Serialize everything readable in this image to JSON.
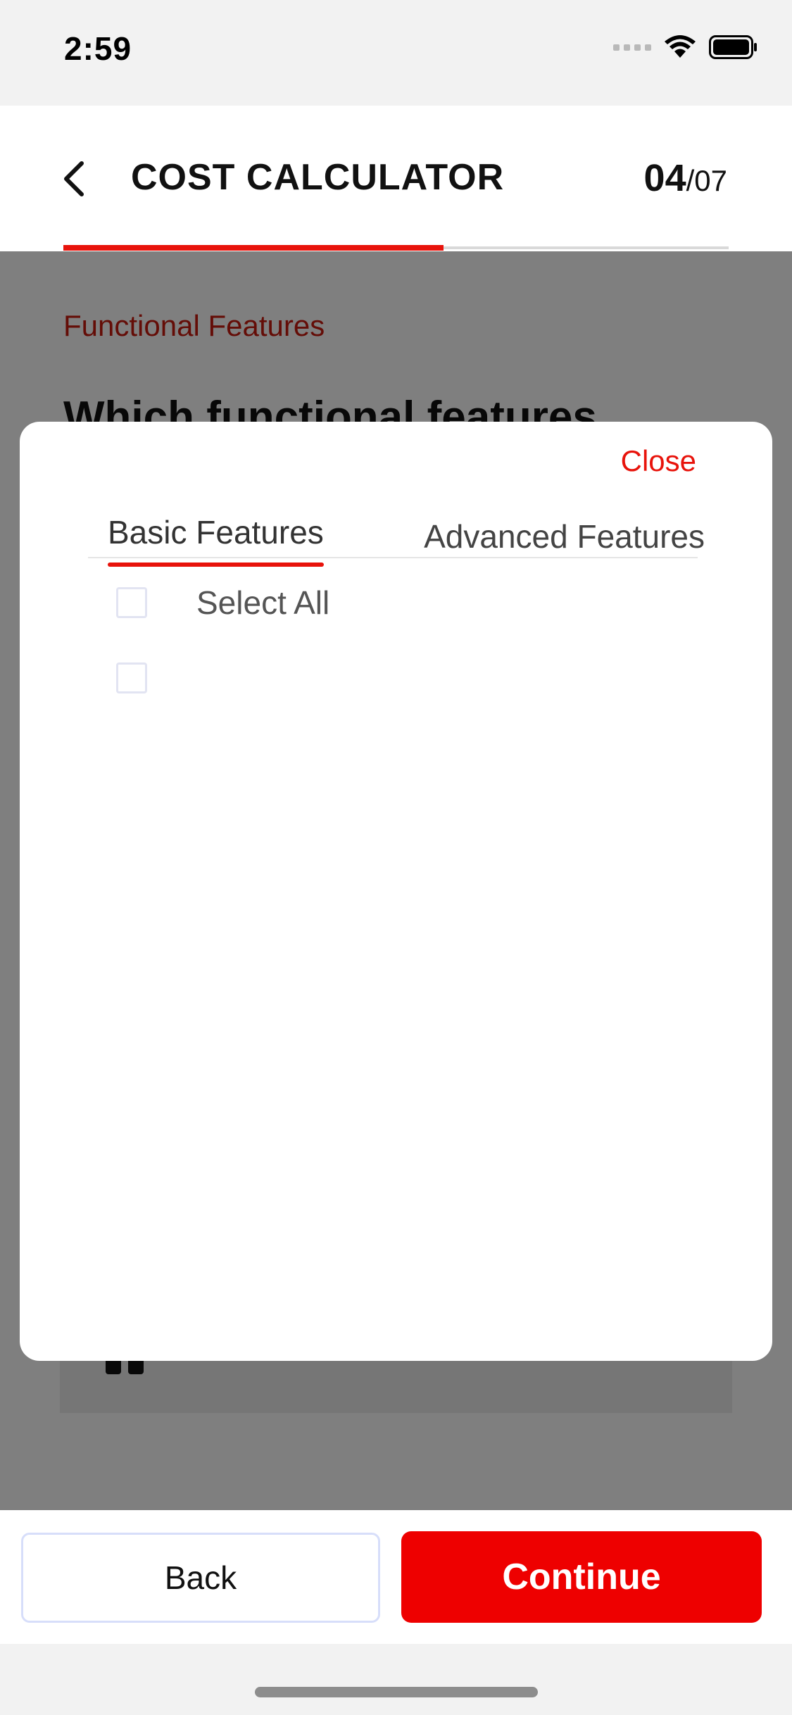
{
  "status_bar": {
    "time": "2:59"
  },
  "header": {
    "title": "COST CALCULATOR",
    "step_current": "04",
    "step_total": "/07",
    "progress_fraction": 0.5714
  },
  "content": {
    "section_label": "Functional Features",
    "question": "Which functional features"
  },
  "modal": {
    "close_label": "Close",
    "tabs": [
      {
        "label": "Basic Features",
        "active": true
      },
      {
        "label": "Advanced Features",
        "active": false
      }
    ],
    "items": [
      {
        "label": "Select All",
        "checked": false
      },
      {
        "label": "",
        "checked": false
      }
    ]
  },
  "footer": {
    "back_label": "Back",
    "continue_label": "Continue"
  },
  "colors": {
    "accent": "#e8130b",
    "continue_bg": "#ee0000",
    "section_label": "#c81a0f"
  }
}
